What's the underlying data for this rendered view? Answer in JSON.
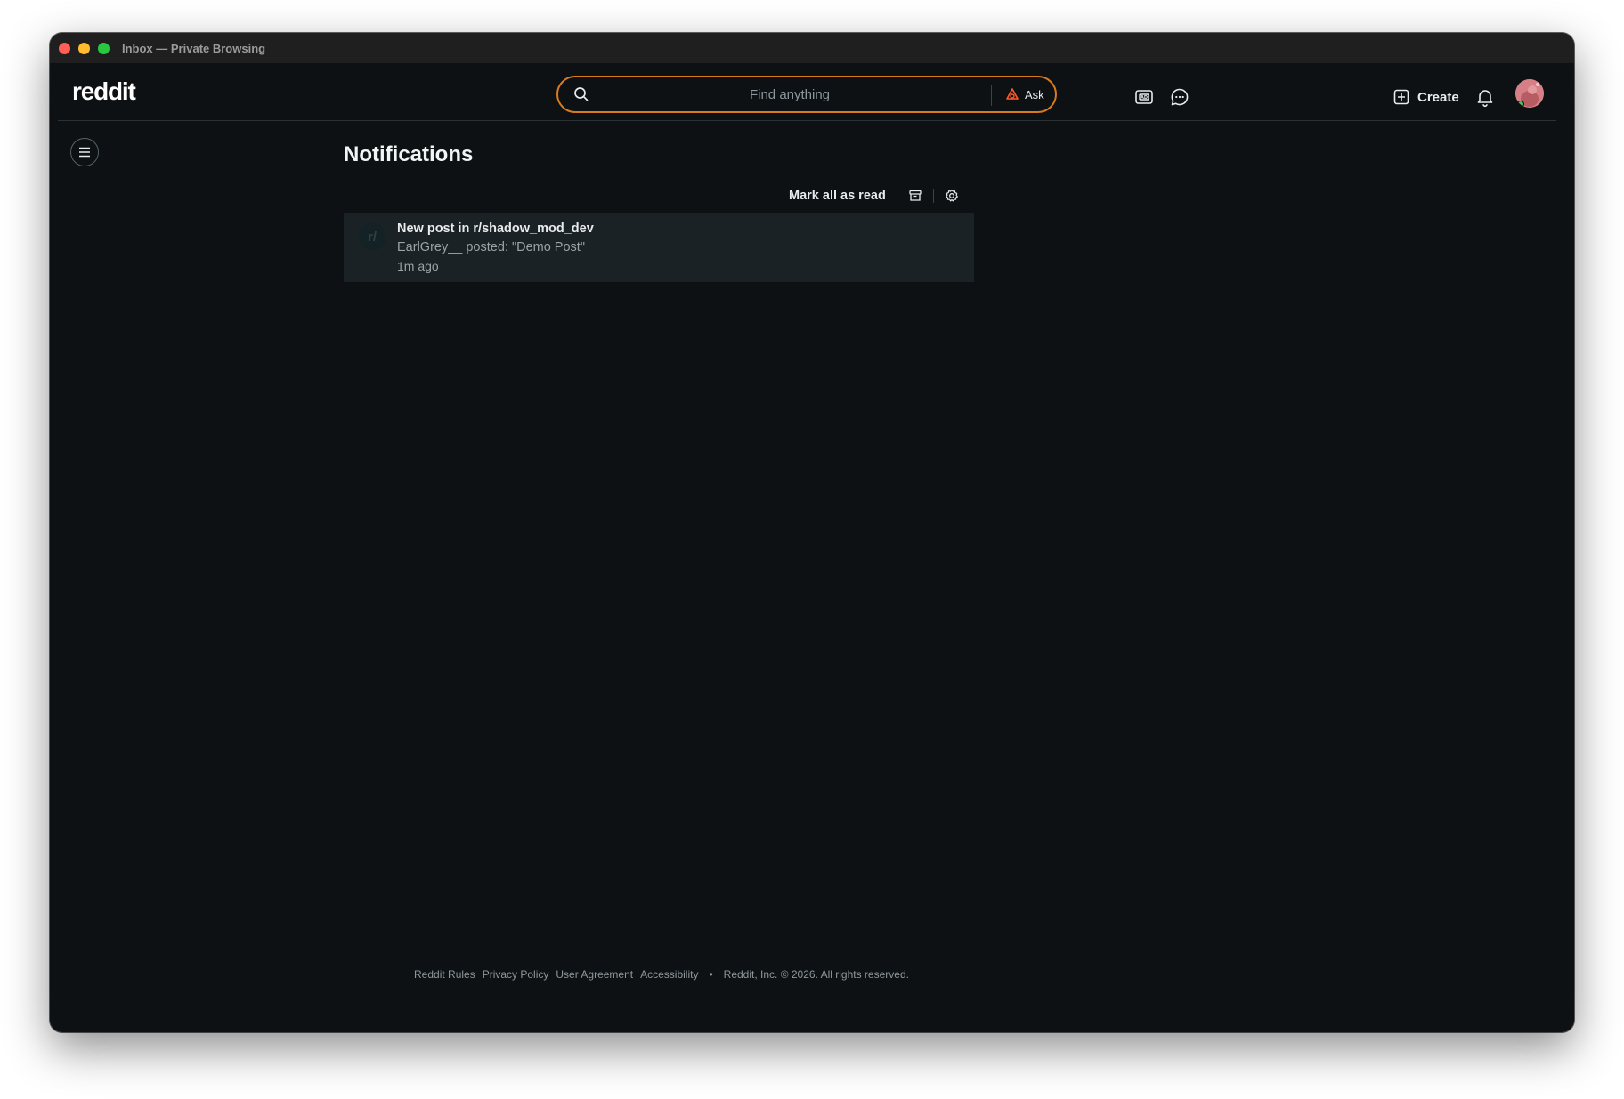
{
  "window": {
    "title": "Inbox — Private Browsing"
  },
  "header": {
    "logo": "reddit",
    "search": {
      "placeholder": "Find anything",
      "value": "",
      "ask_label": "Ask"
    },
    "create_label": "Create",
    "icons": [
      "advertise-icon",
      "chat-icon",
      "create-plus-icon",
      "bell-icon",
      "avatar"
    ]
  },
  "main": {
    "title": "Notifications",
    "actions": {
      "mark_all_read": "Mark all as read"
    },
    "notifications": [
      {
        "avatar_text": "r/",
        "title": "New post in r/shadow_mod_dev",
        "body": "EarlGrey__ posted: \"Demo Post\"",
        "time": "1m ago"
      }
    ]
  },
  "footer": {
    "links": [
      "Reddit Rules",
      "Privacy Policy",
      "User Agreement",
      "Accessibility"
    ],
    "separator": "•",
    "copyright": "Reddit, Inc. © 2026. All rights reserved."
  },
  "colors": {
    "background": "#0e1113",
    "search_border": "#d97a1e",
    "card": "#1b2226",
    "text": "#e9eaeb",
    "muted": "#9aa3a8"
  }
}
